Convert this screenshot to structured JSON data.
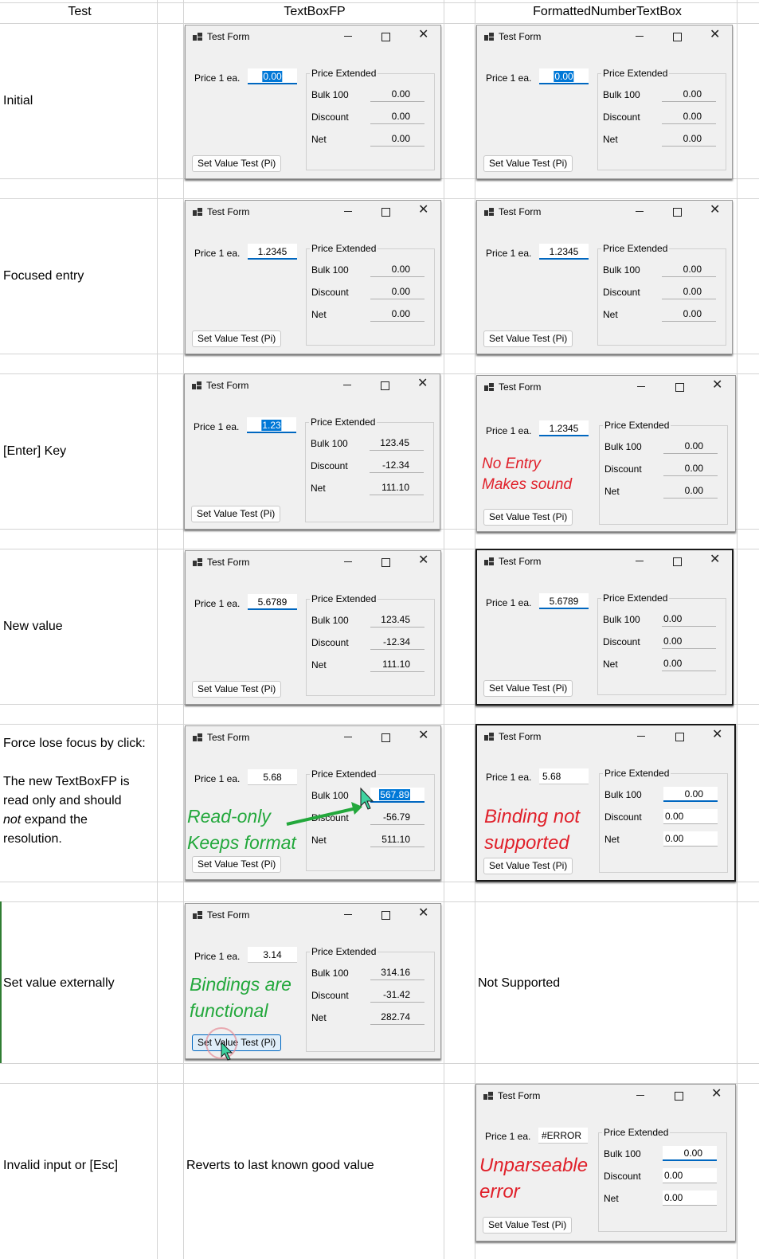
{
  "headers": {
    "test": "Test",
    "textboxfp": "TextBoxFP",
    "fntb": "FormattedNumberTextBox"
  },
  "rows": [
    {
      "label": "Initial"
    },
    {
      "label": "Focused entry"
    },
    {
      "label": "[Enter] Key"
    },
    {
      "label": "New value"
    },
    {
      "label_1": "Force lose focus by click:",
      "label_2": "The new TextBoxFP is",
      "label_3": "read only and should",
      "label_4_em": "not",
      "label_4_rest": " expand the",
      "label_5": "resolution."
    },
    {
      "label": "Set value externally",
      "fntb_text": "Not Supported"
    },
    {
      "label": "Invalid input or [Esc]",
      "fp_text": "Reverts to last known good value"
    }
  ],
  "form": {
    "title": "Test Form",
    "price_label": "Price 1 ea.",
    "group_title": "Price Extended",
    "bulk_label": "Bulk 100",
    "discount_label": "Discount",
    "net_label": "Net",
    "button_label": "Set Value Test (Pi)"
  },
  "windows": {
    "w1": {
      "price": "0.00",
      "bulk": "0.00",
      "discount": "0.00",
      "net": "0.00"
    },
    "w2": {
      "price": "0.00",
      "bulk": "0.00",
      "discount": "0.00",
      "net": "0.00"
    },
    "w3": {
      "price": "1.2345",
      "bulk": "0.00",
      "discount": "0.00",
      "net": "0.00"
    },
    "w4": {
      "price": "1.2345",
      "bulk": "0.00",
      "discount": "0.00",
      "net": "0.00"
    },
    "w5": {
      "price": "1.23",
      "bulk": "123.45",
      "discount": "-12.34",
      "net": "111.10"
    },
    "w6": {
      "price": "1.2345",
      "bulk": "0.00",
      "discount": "0.00",
      "net": "0.00"
    },
    "w7": {
      "price": "5.6789",
      "bulk": "123.45",
      "discount": "-12.34",
      "net": "111.10"
    },
    "w8": {
      "price": "5.6789",
      "bulk": "0.00",
      "discount": "0.00",
      "net": "0.00"
    },
    "w9": {
      "price": "5.68",
      "bulk": "567.89",
      "discount": "-56.79",
      "net": "511.10"
    },
    "w10": {
      "price": "5.68",
      "bulk": "0.00",
      "discount": "0.00",
      "net": "0.00"
    },
    "w11": {
      "price": "3.14",
      "bulk": "314.16",
      "discount": "-31.42",
      "net": "282.74"
    },
    "w12": {
      "price": "#ERROR",
      "bulk": "0.00",
      "discount": "0.00",
      "net": "0.00"
    }
  },
  "annotations": {
    "no_entry_1": "No Entry",
    "no_entry_2": "Makes sound",
    "readonly_1": "Read-only",
    "readonly_2": "Keeps format",
    "binding_1": "Binding not",
    "binding_2": "supported",
    "bindings_1": "Bindings are",
    "bindings_2": "functional",
    "unparse_1": "Unparseable",
    "unparse_2": "error"
  },
  "colors": {
    "selection": "#0078d7",
    "red_note": "#e0202a",
    "green_note": "#23a83c",
    "focus_underline": "#0067c0"
  }
}
